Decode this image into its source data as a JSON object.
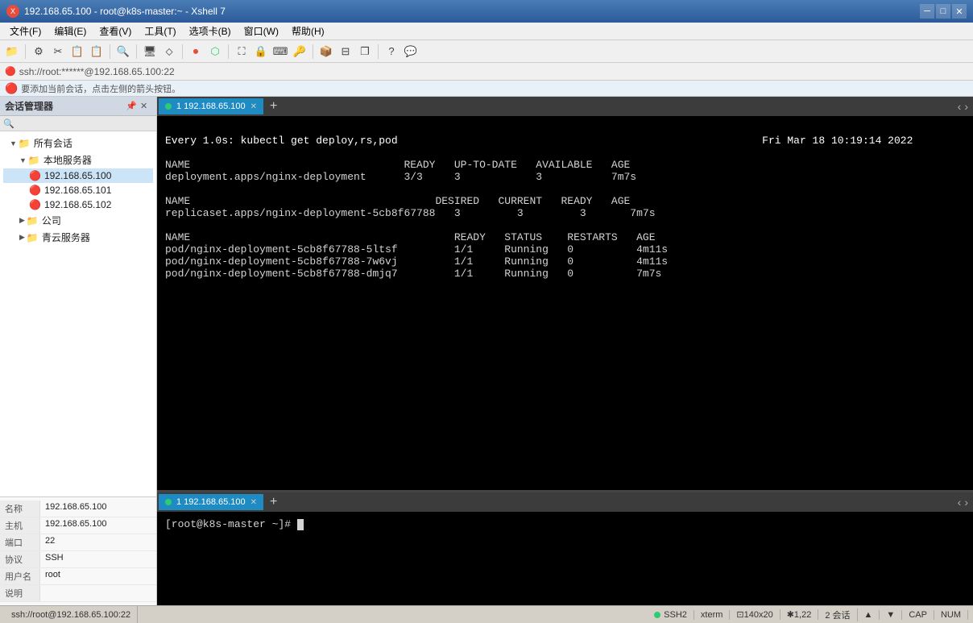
{
  "window": {
    "title": "192.168.65.100 - root@k8s-master:~ - Xshell 7",
    "icon": "X"
  },
  "menu": {
    "items": [
      "文件(F)",
      "编辑(E)",
      "查看(V)",
      "工具(T)",
      "选项卡(B)",
      "窗口(W)",
      "帮助(H)"
    ]
  },
  "address_bar": {
    "text": "ssh://root:******@192.168.65.100:22"
  },
  "info_bar": {
    "text": "要添加当前会话，点击左侧的箭头按钮。"
  },
  "session_panel": {
    "title": "会话管理器",
    "tree": [
      {
        "level": 1,
        "type": "folder",
        "label": "所有会话",
        "expanded": true,
        "arrow": "▼"
      },
      {
        "level": 2,
        "type": "folder",
        "label": "本地服务器",
        "expanded": true,
        "arrow": "▼"
      },
      {
        "level": 3,
        "type": "conn",
        "label": "192.168.65.100"
      },
      {
        "level": 3,
        "type": "conn",
        "label": "192.168.65.101"
      },
      {
        "level": 3,
        "type": "conn",
        "label": "192.168.65.102"
      },
      {
        "level": 2,
        "type": "folder",
        "label": "公司",
        "expanded": false,
        "arrow": "▶"
      },
      {
        "level": 2,
        "type": "folder",
        "label": "青云服务器",
        "expanded": false,
        "arrow": "▶"
      }
    ],
    "props": [
      {
        "key": "名称",
        "val": "192.168.65.100"
      },
      {
        "key": "主机",
        "val": "192.168.65.100"
      },
      {
        "key": "端口",
        "val": "22"
      },
      {
        "key": "协议",
        "val": "SSH"
      },
      {
        "key": "用户名",
        "val": "root"
      },
      {
        "key": "说明",
        "val": ""
      }
    ]
  },
  "tabs": {
    "top": {
      "items": [
        {
          "label": "1 192.168.65.100",
          "active": true
        }
      ],
      "add_label": "+"
    },
    "bottom": {
      "items": [
        {
          "label": "1 192.168.65.100",
          "active": true
        }
      ],
      "add_label": "+"
    }
  },
  "terminal_top": {
    "command": "Every 1.0s: kubectl get deploy,rs,pod",
    "timestamp": "Fri Mar 18 10:19:14 2022",
    "table1_headers": "NAME                                  READY   UP-TO-DATE   AVAILABLE   AGE",
    "table1_row1": "deployment.apps/nginx-deployment      3/3     3            3           7m7s",
    "table2_headers": "NAME                                       DESIRED   CURRENT   READY   AGE",
    "table2_row1": "replicaset.apps/nginx-deployment-5cb8f67788   3         3         3       7m7s",
    "table3_headers": "NAME                                          READY   STATUS    RESTARTS   AGE",
    "table3_row1": "pod/nginx-deployment-5cb8f67788-5ltsf         1/1     Running   0          4m11s",
    "table3_row2": "pod/nginx-deployment-5cb8f67788-7w6vj         1/1     Running   0          4m11s",
    "table3_row3": "pod/nginx-deployment-5cb8f67788-dmjq7         1/1     Running   0          7m7s"
  },
  "terminal_bottom": {
    "prompt": "[root@k8s-master ~]# "
  },
  "status_bar": {
    "ssh": "SSH2",
    "xterm": "xterm",
    "size": "140x20",
    "position": "1,22",
    "sessions": "2 会话",
    "caps": "CAP",
    "num": "NUM"
  }
}
